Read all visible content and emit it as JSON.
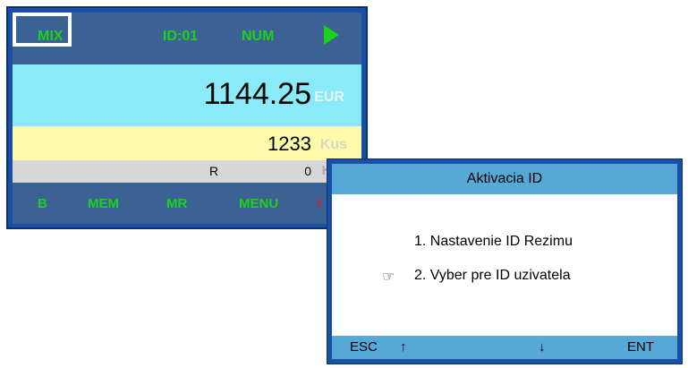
{
  "main_screen": {
    "top_bar": {
      "mix": "MIX",
      "id": "ID:01",
      "num": "NUM",
      "play_icon": "play-icon"
    },
    "price": {
      "value": "1144.25",
      "unit": "EUR"
    },
    "quantity": {
      "value": "1233",
      "unit": "Kus"
    },
    "r_row": {
      "label": "R",
      "value": "0",
      "unit": "Kus"
    },
    "bottom_bar": {
      "b": "B",
      "mem": "MEM",
      "mr": "MR",
      "menu": "MENU",
      "alert": "!"
    }
  },
  "dialog": {
    "title": "Aktivacia ID",
    "items": [
      {
        "label": "1. Nastavenie ID Rezimu"
      },
      {
        "label": "2. Vyber pre ID uzivatela"
      }
    ],
    "pointer_glyph": "☞",
    "footer": {
      "esc": "ESC",
      "up": "↑",
      "down": "↓",
      "ent": "ENT"
    }
  },
  "colors": {
    "accent_green": "#19d219",
    "bar_blue": "#3c6193",
    "price_bg": "#8aeaf7",
    "qty_bg": "#fdfbaa",
    "dialog_header": "#56a9d7",
    "alert_red": "#e81b1b"
  }
}
